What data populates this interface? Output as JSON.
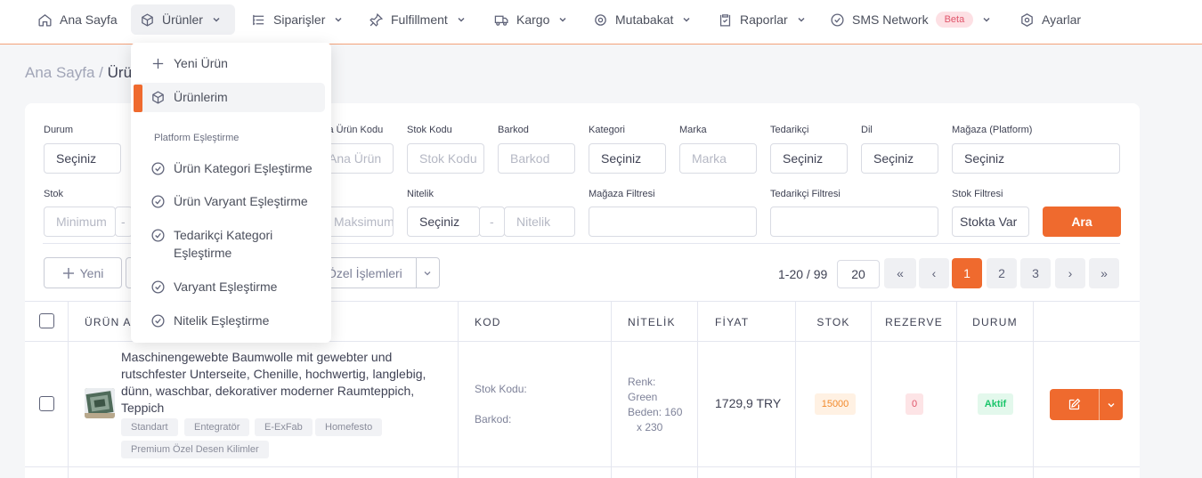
{
  "nav": {
    "items": [
      {
        "label": "Ana Sayfa",
        "icon": "home-icon"
      },
      {
        "label": "Ürünler",
        "icon": "box-icon",
        "active": true
      },
      {
        "label": "Siparişler",
        "icon": "list-tree-icon"
      },
      {
        "label": "Fulfillment",
        "icon": "pin-icon"
      },
      {
        "label": "Kargo",
        "icon": "truck-icon"
      },
      {
        "label": "Mutabakat",
        "icon": "coin-icon"
      },
      {
        "label": "Raporlar",
        "icon": "clipboard-icon"
      },
      {
        "label": "SMS Network",
        "icon": "check-circle-icon",
        "badge": "Beta"
      },
      {
        "label": "Ayarlar",
        "icon": "settings-hex-icon"
      }
    ]
  },
  "breadcrumb": {
    "home": "Ana Sayfa /",
    "current": "Ürünlerim"
  },
  "dropdown": {
    "new_product": "Yeni Ürün",
    "my_products": "Ürünlerim",
    "section": "Platform Eşleştirme",
    "items": [
      "Ürün Kategori Eşleştirme",
      "Ürün Varyant Eşleştirme",
      "Tedarikçi Kategori Eşleştirme",
      "Varyant Eşleştirme",
      "Nitelik Eşleştirme"
    ]
  },
  "filters": {
    "durum": {
      "label": "Durum",
      "value": "Seçiniz"
    },
    "ana_urun_kodu": {
      "label": "Ana Ürün Kodu",
      "placeholder": "Ana Ürün"
    },
    "stok_kodu": {
      "label": "Stok Kodu",
      "placeholder": "Stok Kodu"
    },
    "barkod": {
      "label": "Barkod",
      "placeholder": "Barkod"
    },
    "kategori": {
      "label": "Kategori",
      "value": "Seçiniz"
    },
    "marka": {
      "label": "Marka",
      "placeholder": "Marka"
    },
    "tedarikci": {
      "label": "Tedarikçi",
      "value": "Seçiniz"
    },
    "dil": {
      "label": "Dil",
      "value": "Seçiniz"
    },
    "magaza": {
      "label": "Mağaza (Platform)",
      "value": "Seçiniz"
    },
    "stok": {
      "label": "Stok",
      "min_placeholder": "Minimum",
      "dash": "-"
    },
    "fiyat": {
      "max_placeholder": "Maksimum"
    },
    "nitelik": {
      "label": "Nitelik",
      "value": "Seçiniz",
      "dash": "-",
      "placeholder": "Nitelik"
    },
    "magaza_filtresi": {
      "label": "Mağaza Filtresi",
      "value": ""
    },
    "tedarikci_filtresi": {
      "label": "Tedarikçi Filtresi",
      "value": ""
    },
    "stok_filtresi": {
      "label": "Stok Filtresi",
      "value": "Stokta Var"
    },
    "search_button": "Ara"
  },
  "toolbar": {
    "new_button": "Yeni",
    "bulk_actions": "Özel İşlemleri",
    "page_count": "1-20 / 99",
    "page_size": "20",
    "first": "«",
    "prev": "‹",
    "pages": [
      "1",
      "2",
      "3"
    ],
    "next": "›",
    "last": "»"
  },
  "table": {
    "headers": {
      "name": "ÜRÜN ADI",
      "code": "KOD",
      "attribute": "NİTELİK",
      "price": "FİYAT",
      "stock": "STOK",
      "reserve": "REZERVE",
      "status": "DURUM"
    },
    "rows": [
      {
        "name": "Maschinengewebte Baumwolle mit gewebter und rutschfester Unterseite, Chenille, hochwertig, langlebig, dünn, waschbar, dekorativer moderner Raumteppich, Teppich",
        "tags": [
          "Standart",
          "Entegratör",
          "E-ExFab",
          "Homefesto",
          "Premium Özel Desen Kilimler"
        ],
        "stock_code_label": "Stok Kodu:",
        "barcode_label": "Barkod:",
        "attributes": [
          "Renk:",
          "Green",
          "Beden: 160",
          "x 230"
        ],
        "price": "1729,9 TRY",
        "stock": "15000",
        "reserve": "0",
        "status": "Aktif"
      }
    ]
  },
  "colors": {
    "accent": "#ef6a2e",
    "beta_bg": "#fde0e4",
    "status_green": "#1bc56b"
  }
}
